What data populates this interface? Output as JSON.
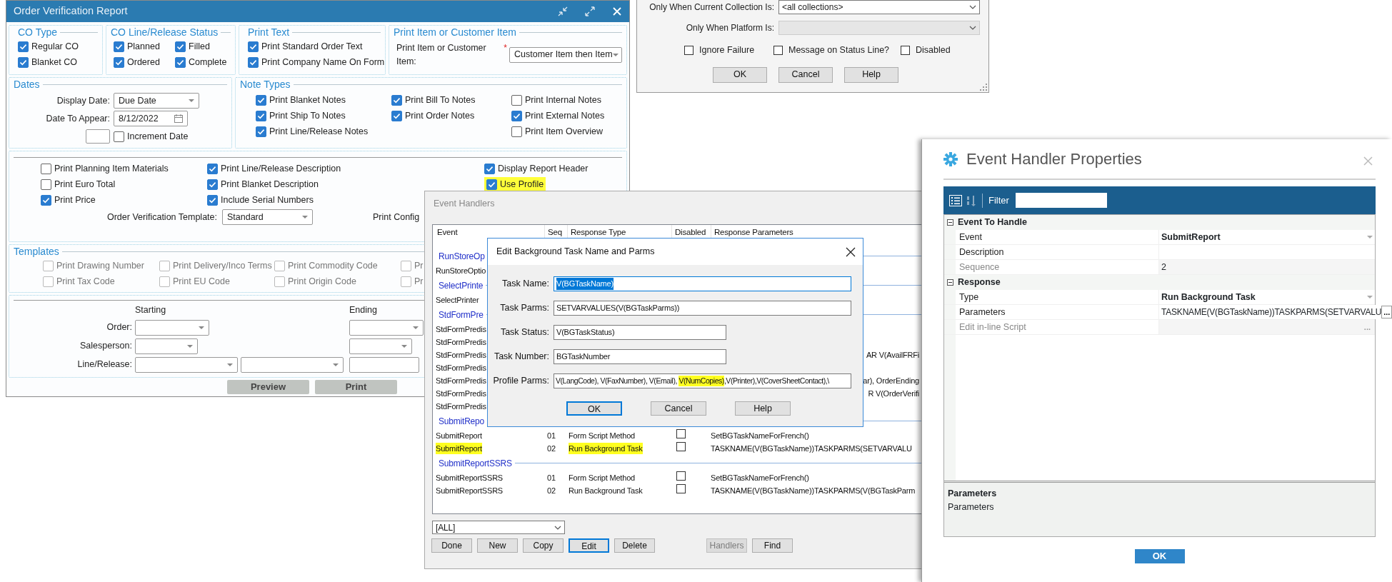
{
  "order_verification": {
    "title": "Order Verification Report",
    "co_type": {
      "title": "CO Type",
      "options": [
        {
          "label": "Regular CO",
          "checked": true
        },
        {
          "label": "Blanket CO",
          "checked": true
        }
      ]
    },
    "line_status": {
      "title": "CO Line/Release Status",
      "options": [
        {
          "label": "Planned",
          "checked": true
        },
        {
          "label": "Filled",
          "checked": true
        },
        {
          "label": "Ordered",
          "checked": true
        },
        {
          "label": "Complete",
          "checked": true
        }
      ]
    },
    "print_text": {
      "title": "Print Text",
      "options": [
        {
          "label": "Print Standard Order Text",
          "checked": true
        },
        {
          "label": "Print Company Name On Form",
          "checked": true
        }
      ]
    },
    "print_item": {
      "title": "Print Item or Customer Item",
      "label": "Print Item or Customer Item:",
      "required_mark": "*",
      "value": "Customer Item then Item"
    },
    "dates": {
      "title": "Dates",
      "display_date": {
        "label": "Display Date:",
        "value": "Due Date"
      },
      "date_to_appear": {
        "label": "Date To Appear:",
        "value": "8/12/2022"
      },
      "increment_date": {
        "label": "Increment Date",
        "checked": false
      }
    },
    "note_types": {
      "title": "Note Types",
      "columns": [
        [
          {
            "label": "Print Blanket Notes",
            "checked": true
          },
          {
            "label": "Print Ship To Notes",
            "checked": true
          },
          {
            "label": "Print Line/Release Notes",
            "checked": true
          }
        ],
        [
          {
            "label": "Print Bill To Notes",
            "checked": true
          },
          {
            "label": "Print Order Notes",
            "checked": true
          }
        ],
        [
          {
            "label": "Print Internal Notes",
            "checked": false
          },
          {
            "label": "Print External Notes",
            "checked": true
          },
          {
            "label": "Print Item Overview",
            "checked": false
          }
        ]
      ]
    },
    "options": {
      "columns": [
        [
          {
            "label": "Print Planning Item Materials",
            "checked": false,
            "highlighted": false
          },
          {
            "label": "Print Euro Total",
            "checked": false,
            "highlighted": false
          },
          {
            "label": "Print Price",
            "checked": true,
            "highlighted": false
          }
        ],
        [
          {
            "label": "Print Line/Release Description",
            "checked": true,
            "highlighted": false
          },
          {
            "label": "Print Blanket Description",
            "checked": true,
            "highlighted": false
          },
          {
            "label": "Include Serial Numbers",
            "checked": true,
            "highlighted": false
          }
        ],
        [
          {
            "label": "Display Report Header",
            "checked": true,
            "highlighted": false
          },
          {
            "label": "Use Profile",
            "checked": true,
            "highlighted": true
          }
        ]
      ],
      "template": {
        "label": "Order Verification Template:",
        "value": "Standard"
      },
      "config_label": "Print Config"
    },
    "templates": {
      "title": "Templates",
      "options": [
        {
          "label": "Print Drawing Number",
          "checked": false,
          "disabled": true
        },
        {
          "label": "Print Delivery/Inco Terms",
          "checked": false,
          "disabled": true
        },
        {
          "label": "Print Commodity Code",
          "checked": false,
          "disabled": true
        },
        {
          "label": "Pr",
          "checked": false,
          "disabled": true
        },
        {
          "label": "Print Tax Code",
          "checked": false,
          "disabled": true
        },
        {
          "label": "Print EU Code",
          "checked": false,
          "disabled": true
        },
        {
          "label": "Print Origin Code",
          "checked": false,
          "disabled": true
        },
        {
          "label": "Pr",
          "checked": false,
          "disabled": true
        }
      ]
    },
    "range": {
      "starting": "Starting",
      "ending": "Ending",
      "rows": [
        {
          "label": "Order:",
          "kind": "wide"
        },
        {
          "label": "Salesperson:",
          "kind": "narrow"
        },
        {
          "label": "Line/Release:",
          "kind": "pair"
        }
      ]
    },
    "buttons": [
      {
        "label": "Preview"
      },
      {
        "label": "Print"
      }
    ]
  },
  "handler_options": {
    "fields": [
      {
        "label": "Only When Current Collection Is:",
        "value": "<all collections>",
        "disabled": false
      },
      {
        "label": "Only When Platform Is:",
        "disabled": true
      }
    ],
    "checkboxes": [
      {
        "label": "Ignore Failure",
        "checked": false
      },
      {
        "label": "Message on Status Line?",
        "checked": false
      },
      {
        "label": "Disabled",
        "checked": false
      }
    ],
    "buttons": [
      {
        "label": "OK"
      },
      {
        "label": "Cancel"
      },
      {
        "label": "Help"
      }
    ]
  },
  "event_handlers": {
    "title": "Event Handlers",
    "columns": [
      "Event",
      "Seq",
      "Response Type",
      "Disabled",
      "Response Parameters"
    ],
    "rows": [
      {
        "kind": "group",
        "event": "RunStoreOp"
      },
      {
        "kind": "covered",
        "event": "RunStoreOptio"
      },
      {
        "kind": "group",
        "event": "SelectPrinte"
      },
      {
        "kind": "covered",
        "event": "SelectPrinter"
      },
      {
        "kind": "group",
        "event": "StdFormPre"
      },
      {
        "kind": "covered",
        "event": "StdFormPredis"
      },
      {
        "kind": "covered",
        "event": "StdFormPredis"
      },
      {
        "kind": "covered",
        "event": "StdFormPredis",
        "params": "AR V(AvailFRFi"
      },
      {
        "kind": "covered",
        "event": "StdFormPredis"
      },
      {
        "kind": "covered",
        "event": "StdFormPredis",
        "params": "ar), OrderEnding"
      },
      {
        "kind": "covered",
        "event": "StdFormPredis",
        "params": "R V(OrderVerifi"
      },
      {
        "kind": "covered",
        "event": "StdFormPredis"
      },
      {
        "kind": "group",
        "event": "SubmitRepo"
      },
      {
        "kind": "handler",
        "event": "SubmitReport",
        "seq": "01",
        "type": "Form Script Method",
        "disabled": false,
        "params": "SetBGTaskNameForFrench()",
        "highlighted": false
      },
      {
        "kind": "handler",
        "event": "SubmitReport",
        "seq": "02",
        "type": "Run Background Task",
        "disabled": false,
        "params": "TASKNAME(V(BGTaskName))TASKPARMS(SETVARVALU",
        "highlighted": true
      },
      {
        "kind": "group",
        "event": "SubmitReportSSRS"
      },
      {
        "kind": "handler",
        "event": "SubmitReportSSRS",
        "seq": "01",
        "type": "Form Script Method",
        "disabled": false,
        "params": "SetBGTaskNameForFrench()",
        "highlighted": false
      },
      {
        "kind": "handler",
        "event": "SubmitReportSSRS",
        "seq": "02",
        "type": "Run Background Task",
        "disabled": false,
        "params": "TASKNAME(V(BGTaskName))TASKPARMS(V(BGTaskParm",
        "highlighted": false
      }
    ],
    "filter": "[ALL]",
    "buttons": [
      {
        "label": "Done",
        "focused": false,
        "disabled": false
      },
      {
        "label": "New",
        "focused": false,
        "disabled": false
      },
      {
        "label": "Copy",
        "focused": false,
        "disabled": false
      },
      {
        "label": "Edit",
        "focused": true,
        "disabled": false
      },
      {
        "label": "Delete",
        "focused": false,
        "disabled": false
      },
      {
        "label": "Handlers",
        "focused": false,
        "disabled": true
      },
      {
        "label": "Find",
        "focused": false,
        "disabled": false
      }
    ]
  },
  "edit_task": {
    "title": "Edit Background Task Name and Parms",
    "fields": [
      {
        "label": "Task Name:",
        "kind": "wide",
        "text_selected": true,
        "value_parts": [
          {
            "text": "V(BGTaskName)",
            "highlighted": false
          }
        ]
      },
      {
        "label": "Task Parms:",
        "kind": "wide",
        "text_selected": false,
        "value_parts": [
          {
            "text": "SETVARVALUES(V(BGTaskParms))",
            "highlighted": false
          }
        ]
      },
      {
        "label": "Task Status:",
        "kind": "short",
        "text_selected": false,
        "value_parts": [
          {
            "text": "V(BGTaskStatus)",
            "highlighted": false
          }
        ]
      },
      {
        "label": "Task Number:",
        "kind": "short",
        "text_selected": false,
        "value_parts": [
          {
            "text": "BGTaskNumber",
            "highlighted": false
          }
        ]
      },
      {
        "label": "Profile Parms:",
        "kind": "wide",
        "text_selected": false,
        "value_parts": [
          {
            "text": "V(LangCode), V(FaxNumber), V(Email), ",
            "highlighted": false
          },
          {
            "text": "V(NumCopies)",
            "highlighted": true
          },
          {
            "text": ",V(Printer),V(CoverSheetContact),\\",
            "highlighted": false
          }
        ]
      }
    ],
    "buttons": [
      {
        "label": "OK",
        "focused": true
      },
      {
        "label": "Cancel",
        "focused": false
      },
      {
        "label": "Help",
        "focused": false
      }
    ]
  },
  "properties": {
    "title": "Event Handler Properties",
    "views": [
      {
        "kind": "categorized",
        "selected": true
      },
      {
        "kind": "alphabetical",
        "selected": false
      }
    ],
    "filter_label": "Filter",
    "categories": [
      {
        "title": "Event To Handle",
        "expanded": true,
        "items": [
          {
            "label": "Event",
            "value": "SubmitReport",
            "kind": "dropdown",
            "readonly": false
          },
          {
            "label": "Description",
            "kind": "text",
            "readonly": false
          },
          {
            "label": "Sequence",
            "value": "2",
            "kind": "text",
            "readonly": true
          }
        ]
      },
      {
        "title": "Response",
        "expanded": true,
        "items": [
          {
            "label": "Type",
            "value": "Run Background Task",
            "kind": "dropdown",
            "readonly": false
          },
          {
            "label": "Parameters",
            "value": "TASKNAME(V(BGTaskName))TASKPARMS(SETVARVALU",
            "kind": "ellipsis",
            "button": "...",
            "readonly": false
          },
          {
            "label": "Edit in-line Script",
            "kind": "ellipsis",
            "button": "...",
            "readonly": true
          }
        ]
      }
    ],
    "description": {
      "title": "Parameters",
      "text": "Parameters"
    },
    "ok": "OK"
  }
}
